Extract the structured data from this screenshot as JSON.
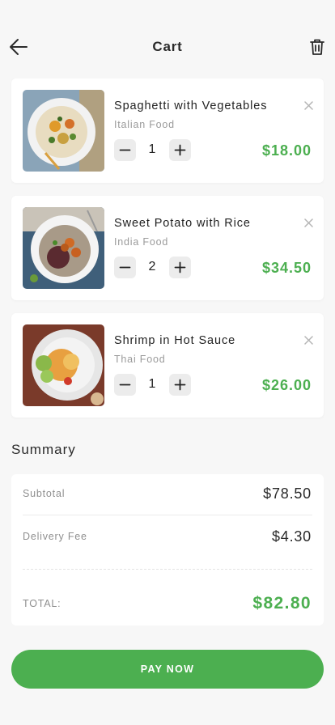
{
  "header": {
    "title": "Cart",
    "back_icon": "arrow-left-icon",
    "trash_icon": "trash-icon"
  },
  "items": [
    {
      "name": "Spaghetti with Vegetables",
      "category": "Italian Food",
      "quantity": "1",
      "price": "$18.00"
    },
    {
      "name": "Sweet Potato with Rice",
      "category": "India Food",
      "quantity": "2",
      "price": "$34.50"
    },
    {
      "name": "Shrimp in Hot Sauce",
      "category": "Thai Food",
      "quantity": "1",
      "price": "$26.00"
    }
  ],
  "summary": {
    "heading": "Summary",
    "subtotal_label": "Subtotal",
    "subtotal_value": "$78.50",
    "delivery_label": "Delivery Fee",
    "delivery_value": "$4.30",
    "total_label": "TOTAL:",
    "total_value": "$82.80"
  },
  "pay_button": {
    "label": "PAY NOW"
  },
  "colors": {
    "accent": "#4caf50",
    "background": "#f7f7f7",
    "card": "#ffffff",
    "text": "#222222",
    "muted": "#9a9a9a"
  }
}
